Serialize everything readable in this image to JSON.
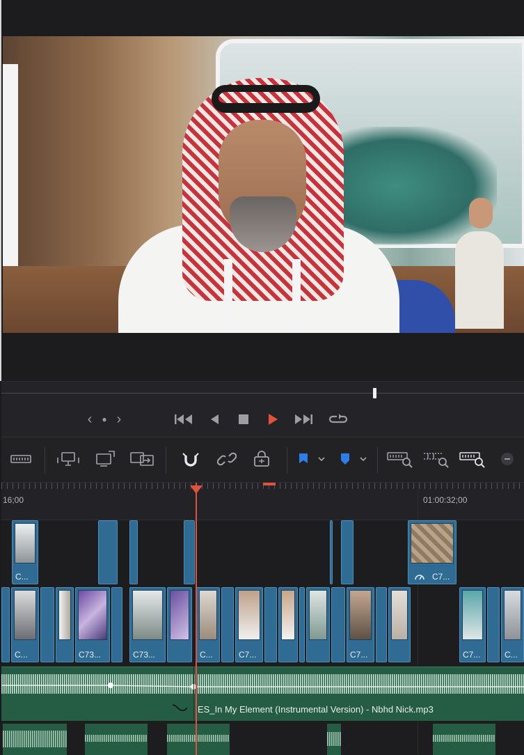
{
  "transport": {
    "nav_prev": "‹",
    "nav_dot": "●",
    "nav_next": "›"
  },
  "timeline": {
    "timecode_left": "16;00",
    "timecode_right": "01:00:32;00",
    "v3_clips": [
      {
        "label": "C..."
      },
      {
        "label": "C7..."
      }
    ],
    "v2_clips": [
      {
        "label": "C..."
      },
      {
        "label": "C73..."
      },
      {
        "label": "C73..."
      },
      {
        "label": "C..."
      },
      {
        "label": "C7..."
      },
      {
        "label": "C7..."
      },
      {
        "label": "C7..."
      },
      {
        "label": "C..."
      }
    ],
    "audio_clip_name": "ES_In My Element (Instrumental Version) - Nbhd Nick.mp3"
  },
  "colors": {
    "playhead": "#e0523c",
    "video_clip": "#2f6b93",
    "audio_clip": "#245d43",
    "play_button": "#e0523c",
    "flag_blue": "#2f7ee8"
  },
  "icons": {
    "transport": [
      "chevron-left-icon",
      "dot-icon",
      "chevron-right-icon",
      "jump-to-start-icon",
      "play-reverse-icon",
      "stop-icon",
      "play-icon",
      "jump-to-end-icon",
      "loop-icon"
    ],
    "toolbar": [
      "trim-edit-icon",
      "insert-clip-icon",
      "overwrite-clip-icon",
      "replace-clip-icon",
      "snapping-magnet-icon",
      "link-icon",
      "position-lock-icon",
      "flag-icon",
      "marker-icon",
      "zoom-full-icon",
      "zoom-detail-icon",
      "zoom-custom-icon",
      "minus-icon"
    ]
  }
}
